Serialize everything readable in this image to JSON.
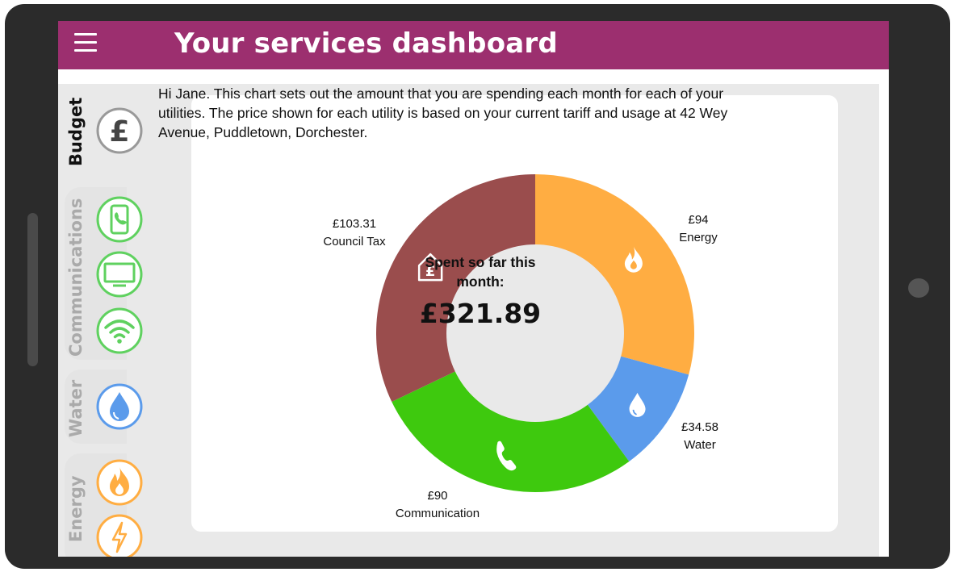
{
  "header": {
    "title": "Your services dashboard"
  },
  "tabs": [
    {
      "label": "Budget",
      "color": "#111111"
    },
    {
      "label": "Communications",
      "color": "#aaaaaa"
    },
    {
      "label": "Water",
      "color": "#aaaaaa"
    },
    {
      "label": "Energy",
      "color": "#aaaaaa"
    }
  ],
  "intro": "Hi Jane. This chart sets out the amount that you are spending each month for each of your utilities. The price shown for each utility is based on your current tariff and usage at 42 Wey Avenue, Puddletown, Dorchester.",
  "center": {
    "label_line1": "Spent so far this",
    "label_line2": "month:",
    "amount": "£321.89"
  },
  "chart_data": {
    "type": "pie",
    "total": 321.89,
    "slices": [
      {
        "name": "Energy",
        "amount": "£94",
        "value": 94,
        "color": "#ffad42",
        "icon": "flame-icon"
      },
      {
        "name": "Water",
        "amount": "£34.58",
        "value": 34.58,
        "color": "#5b9beb",
        "icon": "water-drop-icon"
      },
      {
        "name": "Communication",
        "amount": "£90",
        "value": 90,
        "color": "#3ec90e",
        "icon": "phone-icon"
      },
      {
        "name": "Council Tax",
        "amount": "£103.31",
        "value": 103.31,
        "color": "#9a4d4d",
        "icon": "house-pound-icon"
      }
    ]
  },
  "colors": {
    "brand": "#9c2f6f",
    "green": "#5fd15f",
    "blue": "#5b9beb",
    "orange": "#ffad42"
  }
}
